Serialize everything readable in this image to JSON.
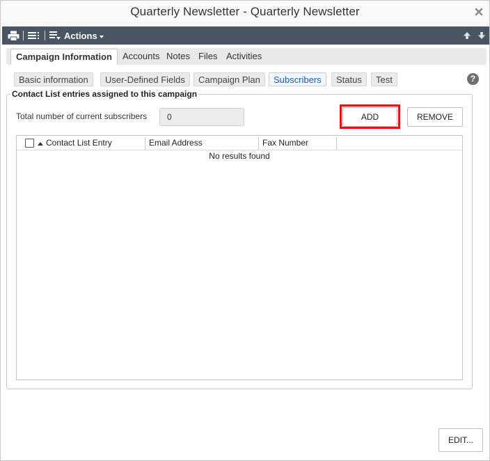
{
  "window": {
    "title": "Quarterly Newsletter - Quarterly Newsletter"
  },
  "toolbar": {
    "actions_label": "Actions",
    "icons": [
      "print-icon",
      "list-icon",
      "detail-list-icon",
      "arrow-up-icon",
      "arrow-down-icon"
    ]
  },
  "main_tabs": [
    {
      "label": "Campaign Information",
      "active": true
    },
    {
      "label": "Accounts",
      "active": false
    },
    {
      "label": "Notes",
      "active": false
    },
    {
      "label": "Files",
      "active": false
    },
    {
      "label": "Activities",
      "active": false
    }
  ],
  "sub_tabs": [
    {
      "label": "Basic information",
      "active": false
    },
    {
      "label": "User-Defined Fields",
      "active": false
    },
    {
      "label": "Campaign Plan",
      "active": false
    },
    {
      "label": "Subscribers",
      "active": true
    },
    {
      "label": "Status",
      "active": false
    },
    {
      "label": "Test",
      "active": false
    }
  ],
  "help": {
    "glyph": "?"
  },
  "section": {
    "legend": "Contact List entries assigned to this campaign",
    "total_label": "Total number of current subscribers",
    "total_value": "0",
    "add_label": "ADD",
    "remove_label": "REMOVE"
  },
  "grid": {
    "columns": [
      "Contact List Entry",
      "Email Address",
      "Fax Number"
    ],
    "empty_text": "No results found"
  },
  "footer": {
    "edit_label": "EDIT..."
  },
  "colors": {
    "toolbar_bg": "#4a5563",
    "highlight": "#e3131b",
    "active_subtab_text": "#1f5fa8"
  }
}
